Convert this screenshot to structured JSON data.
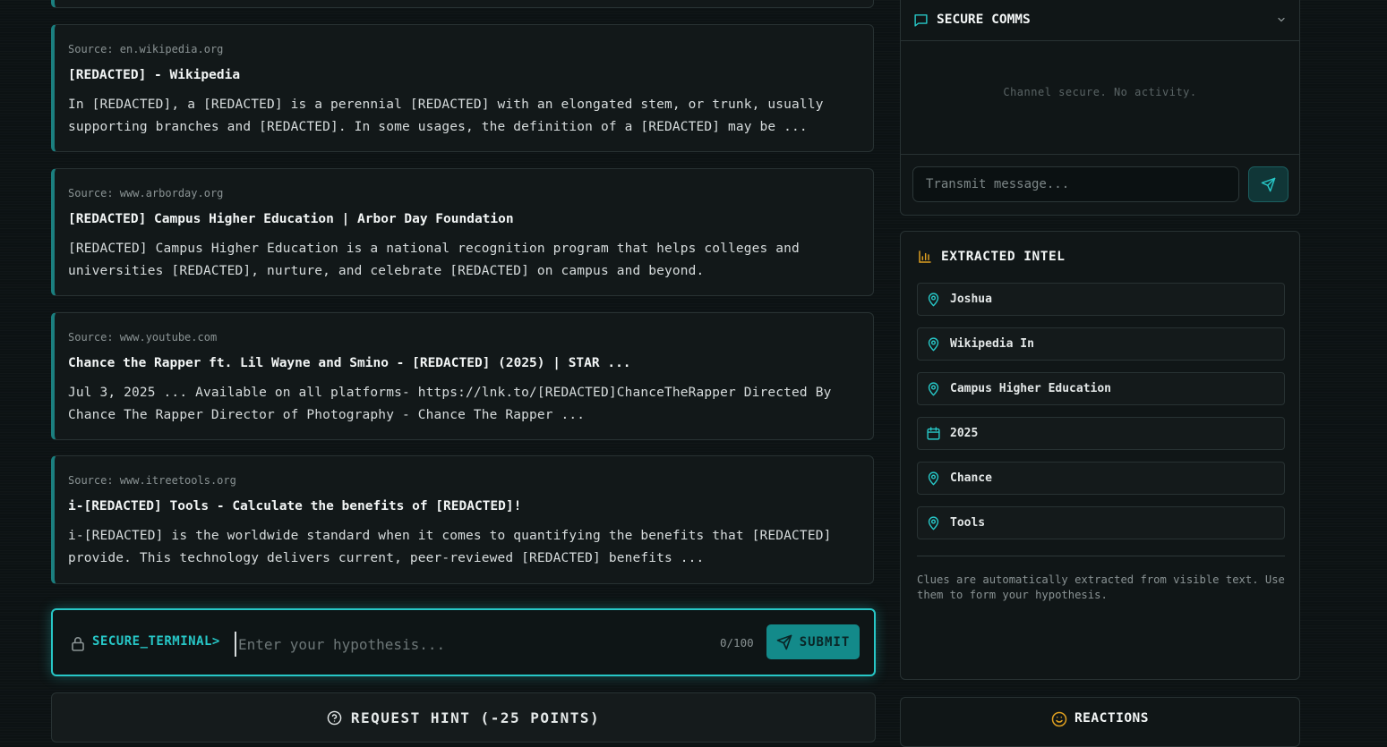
{
  "results": [
    {
      "source": "Source: en.wikipedia.org",
      "title": "[REDACTED] - Wikipedia",
      "snippet": "In [REDACTED], a [REDACTED] is a perennial [REDACTED] with an elongated stem, or trunk, usually supporting branches and [REDACTED]. In some usages, the definition of a [REDACTED] may be ..."
    },
    {
      "source": "Source: www.arborday.org",
      "title": "[REDACTED] Campus Higher Education | Arbor Day Foundation",
      "snippet": "[REDACTED] Campus Higher Education is a national recognition program that helps colleges and universities [REDACTED], nurture, and celebrate [REDACTED] on campus and beyond."
    },
    {
      "source": "Source: www.youtube.com",
      "title": "Chance the Rapper ft. Lil Wayne and Smino - [REDACTED] (2025) | STAR ...",
      "snippet": "Jul 3, 2025 ... Available on all platforms- https://lnk.to/[REDACTED]ChanceTheRapper Directed By Chance The Rapper Director of Photography - Chance The Rapper ..."
    },
    {
      "source": "Source: www.itreetools.org",
      "title": "i-[REDACTED] Tools - Calculate the benefits of [REDACTED]!",
      "snippet": "i-[REDACTED] is the worldwide standard when it comes to quantifying the benefits that [REDACTED] provide. This technology delivers current, peer-reviewed [REDACTED] benefits ..."
    }
  ],
  "terminal": {
    "prompt": "SECURE_TERMINAL>",
    "placeholder": "Enter your hypothesis...",
    "counter": "0/100",
    "submit_label": "SUBMIT"
  },
  "hint": {
    "label": "REQUEST HINT (-25 POINTS)"
  },
  "comms": {
    "title": "SECURE COMMS",
    "empty_text": "Channel secure. No activity.",
    "input_placeholder": "Transmit message..."
  },
  "intel": {
    "title": "EXTRACTED INTEL",
    "clues": [
      {
        "icon": "map-pin-icon",
        "label": "Joshua"
      },
      {
        "icon": "map-pin-icon",
        "label": "Wikipedia In"
      },
      {
        "icon": "map-pin-icon",
        "label": "Campus Higher Education"
      },
      {
        "icon": "calendar-icon",
        "label": "2025"
      },
      {
        "icon": "map-pin-icon",
        "label": "Chance"
      },
      {
        "icon": "map-pin-icon",
        "label": "Tools"
      }
    ],
    "note": "Clues are automatically extracted from visible text. Use them to form your hypothesis."
  },
  "reactions": {
    "label": "REACTIONS"
  },
  "colors": {
    "accent": "#27c7c7",
    "accent_dark": "#138a8a",
    "warning": "#e0a020"
  }
}
